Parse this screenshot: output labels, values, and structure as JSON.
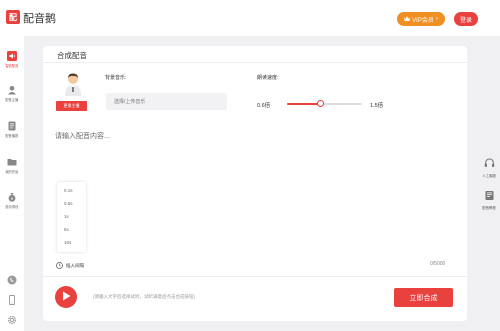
{
  "app": {
    "logo_text": "配",
    "title": "配音鹅",
    "vip_label": "VIP会员",
    "vip_arrow": "›",
    "login_label": "登录",
    "accent_color": "#e8413e",
    "vip_color": "#f08f22"
  },
  "sidebar": {
    "items": [
      {
        "label": "智能配音",
        "icon": "speaker-icon",
        "active": true
      },
      {
        "label": "配音主播",
        "icon": "anchor-icon",
        "active": false
      },
      {
        "label": "配音播报",
        "icon": "document-icon",
        "active": false
      },
      {
        "label": "我的作品",
        "icon": "folder-icon",
        "active": false
      },
      {
        "label": "邀请得钱",
        "icon": "money-bag-icon",
        "active": false
      }
    ],
    "bottom_icons": [
      "phone-icon",
      "mobile-icon",
      "settings-icon"
    ]
  },
  "right_sidebar": {
    "items": [
      {
        "label": "人工客服",
        "icon": "headset-icon"
      },
      {
        "label": "配音教程",
        "icon": "book-icon"
      }
    ]
  },
  "panel": {
    "title": "合成配音",
    "change_anchor_label": "更换主播",
    "background_music_label": "背景音乐:",
    "background_music_placeholder": "选择/上传音乐",
    "speed_label": "朗读速度:",
    "speed_min": "0.6倍",
    "speed_max": "1.5倍",
    "speed_value_fraction": 0.45,
    "content_placeholder": "请输入配音内容...",
    "pause_options": [
      "0.1s",
      "0.5s",
      "1s",
      "5s",
      "10s"
    ],
    "insert_pause_label": "插入间隔",
    "char_count": "0/5000",
    "hint": "(请输入文字后选择试听，试听满意后点击合成按钮)",
    "synthesize_label": "立即合成"
  }
}
